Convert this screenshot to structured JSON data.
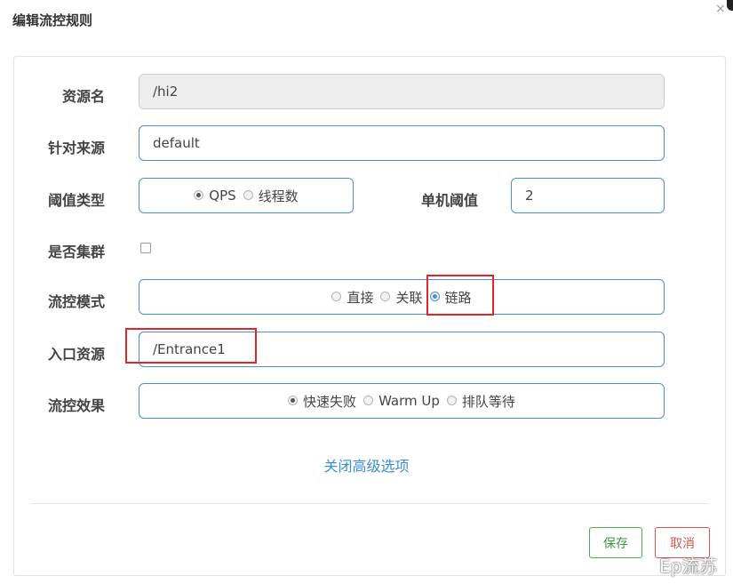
{
  "dialog": {
    "title": "编辑流控规则",
    "close_glyph": "×"
  },
  "form": {
    "resource": {
      "label": "资源名",
      "value": "/hi2"
    },
    "limit_app": {
      "label": "针对来源",
      "value": "default"
    },
    "threshold_type": {
      "label": "阈值类型",
      "options": [
        "QPS",
        "线程数"
      ],
      "selected": "QPS"
    },
    "threshold": {
      "label": "单机阈值",
      "value": "2"
    },
    "cluster": {
      "label": "是否集群",
      "checked": false
    },
    "strategy": {
      "label": "流控模式",
      "options": [
        "直接",
        "关联",
        "链路"
      ],
      "selected": "链路"
    },
    "ref_resource": {
      "label": "入口资源",
      "value": "/Entrance1"
    },
    "control_behavior": {
      "label": "流控效果",
      "options": [
        "快速失败",
        "Warm Up",
        "排队等待"
      ],
      "selected": "快速失败"
    }
  },
  "advanced_toggle": "关闭高级选项",
  "buttons": {
    "save": "保存",
    "cancel": "取消"
  },
  "watermark": "Ep流苏",
  "colors": {
    "input_border": "#4a8fd6",
    "highlight": "#e0262b",
    "save": "#4cae4c",
    "cancel": "#d9534f",
    "link": "#3c8dd5"
  }
}
